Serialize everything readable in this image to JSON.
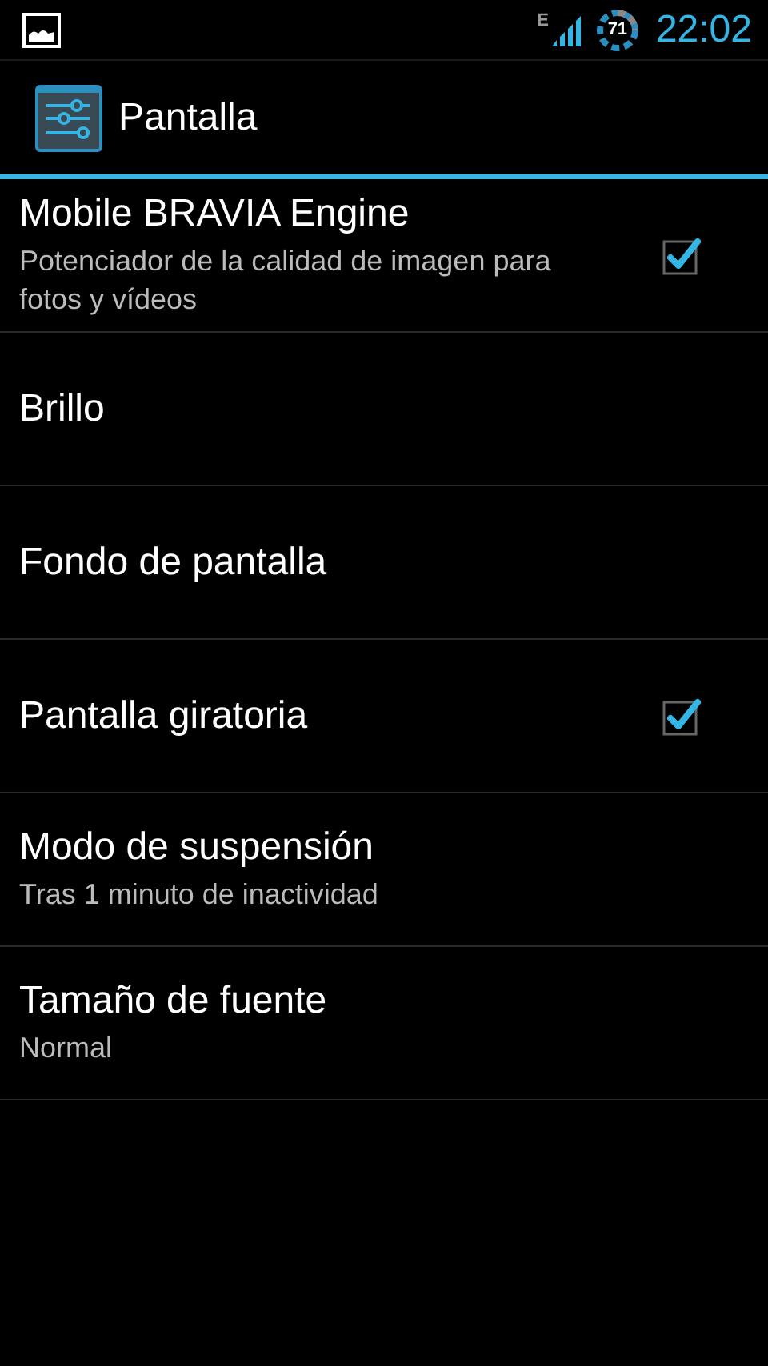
{
  "status_bar": {
    "network_type": "E",
    "battery": "71",
    "time": "22:02"
  },
  "action_bar": {
    "title": "Pantalla"
  },
  "items": [
    {
      "kind": "checkbox",
      "title": "Mobile BRAVIA Engine",
      "summary": "Potenciador de la calidad de imagen para fotos y vídeos",
      "checked": true
    },
    {
      "kind": "plain",
      "title": "Brillo"
    },
    {
      "kind": "plain",
      "title": "Fondo de pantalla"
    },
    {
      "kind": "checkbox",
      "title": "Pantalla giratoria",
      "checked": true
    },
    {
      "kind": "plain",
      "title": "Modo de suspensión",
      "summary": "Tras 1 minuto de inactividad"
    },
    {
      "kind": "plain",
      "title": "Tamaño de fuente",
      "summary": "Normal"
    }
  ]
}
